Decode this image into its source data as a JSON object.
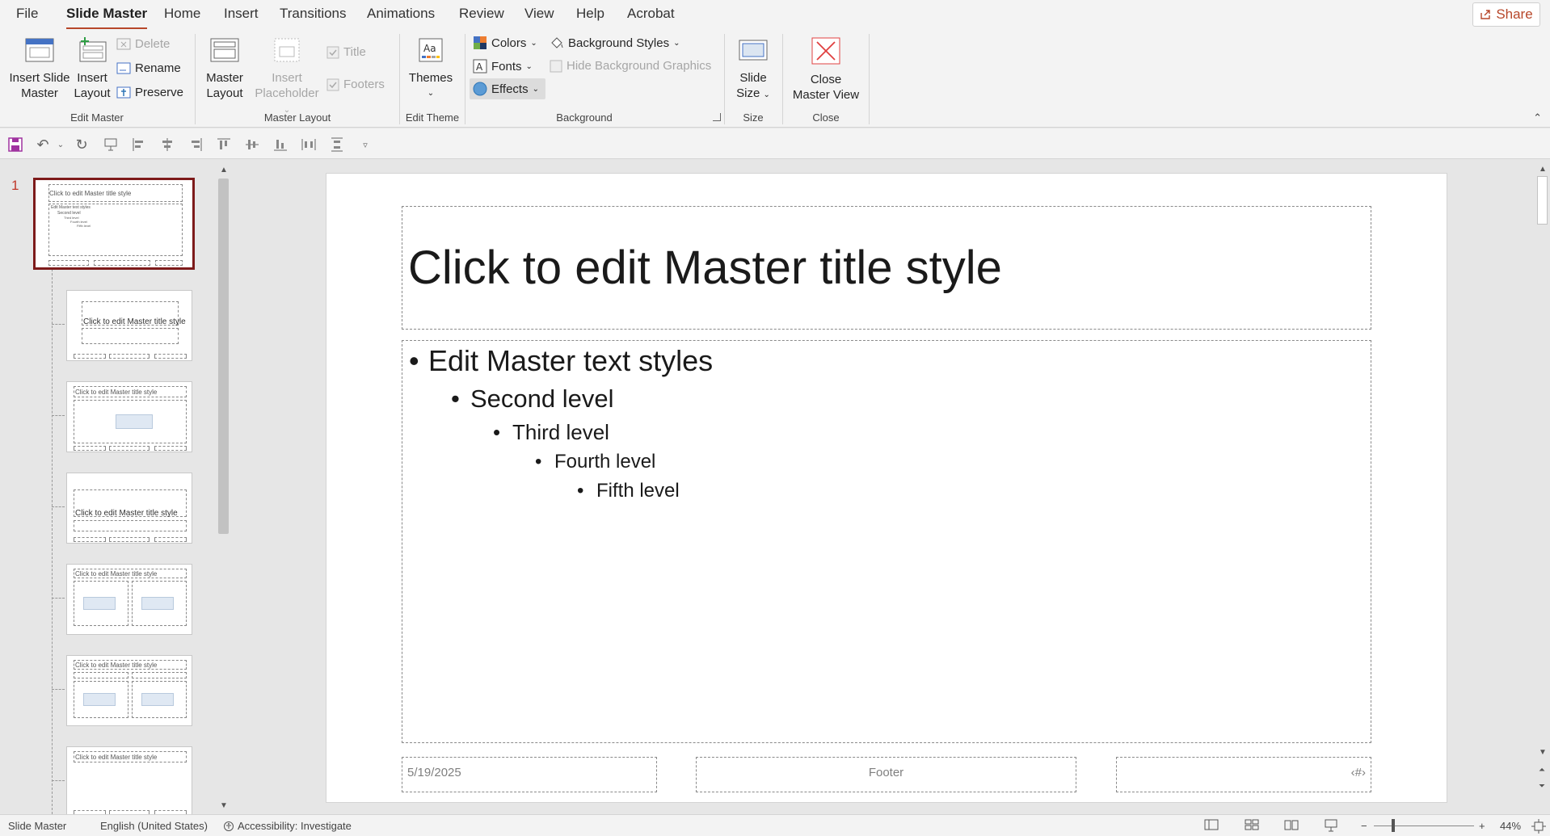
{
  "tabs": [
    "File",
    "Slide Master",
    "Home",
    "Insert",
    "Transitions",
    "Animations",
    "Review",
    "View",
    "Help",
    "Acrobat"
  ],
  "share_label": "Share",
  "ribbon": {
    "edit_master": {
      "insert_slide_master": [
        "Insert Slide",
        "Master"
      ],
      "insert_layout": [
        "Insert",
        "Layout"
      ],
      "delete": "Delete",
      "rename": "Rename",
      "preserve": "Preserve",
      "group_label": "Edit Master"
    },
    "master_layout": {
      "master_layout": [
        "Master",
        "Layout"
      ],
      "insert_placeholder": [
        "Insert",
        "Placeholder"
      ],
      "title": "Title",
      "footers": "Footers",
      "group_label": "Master Layout"
    },
    "edit_theme": {
      "themes": "Themes",
      "group_label": "Edit Theme"
    },
    "background": {
      "colors": "Colors",
      "fonts": "Fonts",
      "effects": "Effects",
      "background_styles": "Background Styles",
      "hide_background_graphics": "Hide Background Graphics",
      "group_label": "Background"
    },
    "size": {
      "slide_size": [
        "Slide",
        "Size"
      ],
      "group_label": "Size"
    },
    "close": {
      "close_master_view": [
        "Close",
        "Master View"
      ],
      "group_label": "Close"
    }
  },
  "thumbnails": {
    "slide_number": "1",
    "master_title": "Click to edit Master title style",
    "master_text": "Edit Master text styles",
    "second": "Second level",
    "third": "Third level",
    "fourth": "Fourth level",
    "fifth": "Fifth level"
  },
  "slide": {
    "title": "Click to edit Master title style",
    "levels": [
      "Edit Master text styles",
      "Second level",
      "Third level",
      "Fourth level",
      "Fifth level"
    ],
    "footer_date": "5/19/2025",
    "footer_text": "Footer",
    "footer_number": "‹#›"
  },
  "status": {
    "mode": "Slide Master",
    "language": "English (United States)",
    "accessibility": "Accessibility: Investigate",
    "zoom": "44%"
  },
  "colors": {
    "accent": "#b7472a",
    "master_border": "#7d1a1a"
  }
}
